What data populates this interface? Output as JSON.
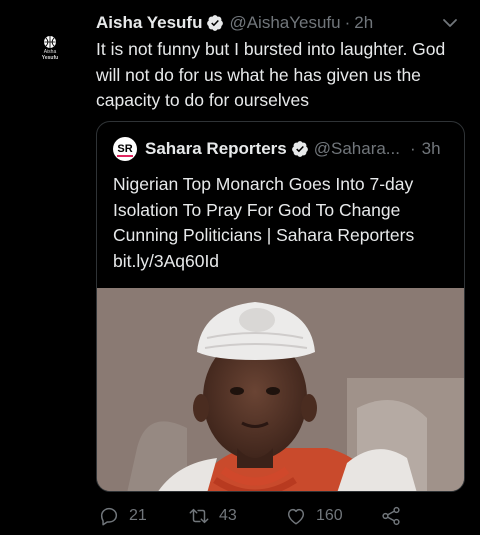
{
  "tweet": {
    "display_name": "Aisha Yesufu",
    "handle": "@AishaYesufu",
    "separator": "·",
    "time": "2h",
    "avatar_label_1": "Aisha",
    "avatar_label_2": "Yesufu",
    "text": "It is not funny but I bursted into laughter. God will not do for us what he has given us the capacity to do for ourselves"
  },
  "quoted": {
    "logo_text": "SR",
    "display_name": "Sahara Reporters",
    "handle": "@Sahara...",
    "separator": "·",
    "time": "3h",
    "text": "Nigerian Top Monarch Goes Into 7-day Isolation To Pray For God To Change Cunning Politicians | Sahara Reporters bit.ly/3Aq60Id"
  },
  "actions": {
    "replies": "21",
    "retweets": "43",
    "likes": "160"
  },
  "colors": {
    "background": "#000000",
    "text": "#e7e9ea",
    "muted": "#71767b",
    "verified": "#1d9bf0",
    "border": "#2f3336"
  }
}
